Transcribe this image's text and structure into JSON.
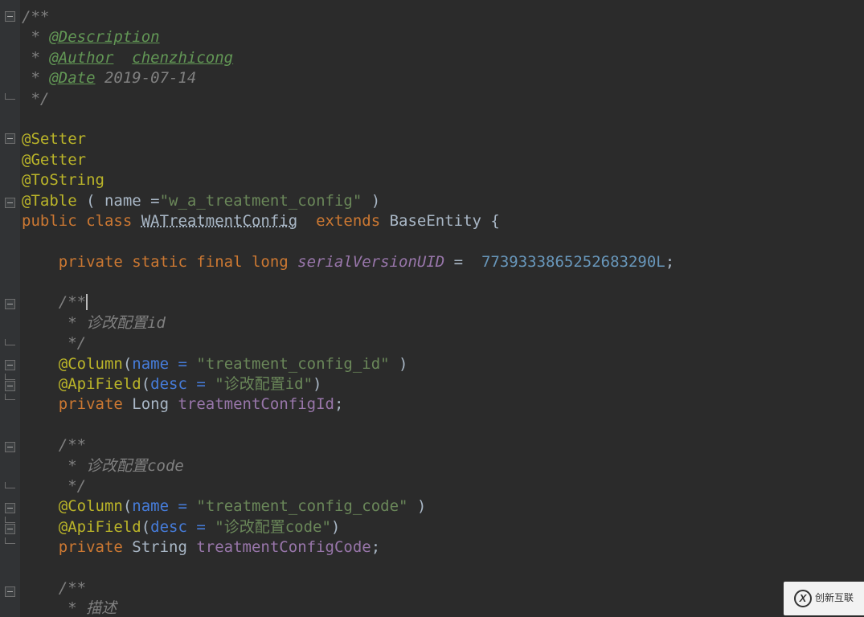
{
  "watermark": {
    "brand_cn": "创新互联",
    "brand_mark": "X"
  },
  "code": {
    "l0": "/**",
    "l1a": " * ",
    "l1b": "@Description",
    "l2a": " * ",
    "l2b": "@Author",
    "l2c": "  ",
    "l2d": "chenzhicong",
    "l3a": " * ",
    "l3b": "@Date",
    "l3c": " 2019-07-14",
    "l4": " */",
    "l5": "",
    "l6": "@Setter",
    "l7": "@Getter",
    "l8": "@ToString",
    "l9a": "@Table ",
    "l9b": "( ",
    "l9c": "name =",
    "l9d": "\"w_a_treatment_config\"",
    "l9e": " )",
    "l10a": "public class ",
    "l10b": "WATreatmentConfig",
    "l10c": "  extends ",
    "l10d": "BaseEntity ",
    "l10e": "{",
    "l11": "",
    "l12a": "    private static final long ",
    "l12b": "serialVersionUID",
    "l12c": " =  ",
    "l12d": "7739333865252683290L",
    "l12e": ";",
    "l13": "",
    "l14": "    /**",
    "l15": "     * 诊改配置id",
    "l16": "     */",
    "l17a": "    ",
    "l17b": "@Column",
    "l17c": "(",
    "l17d": "name = ",
    "l17e": "\"treatment_config_id\"",
    "l17f": " )",
    "l18a": "    ",
    "l18b": "@ApiField",
    "l18c": "(",
    "l18d": "desc = ",
    "l18e": "\"诊改配置id\"",
    "l18f": ")",
    "l19a": "    private ",
    "l19b": "Long ",
    "l19c": "treatmentConfigId",
    "l19d": ";",
    "l20": "",
    "l21": "    /**",
    "l22": "     * 诊改配置code",
    "l23": "     */",
    "l24a": "    ",
    "l24b": "@Column",
    "l24c": "(",
    "l24d": "name = ",
    "l24e": "\"treatment_config_code\"",
    "l24f": " )",
    "l25a": "    ",
    "l25b": "@ApiField",
    "l25c": "(",
    "l25d": "desc = ",
    "l25e": "\"诊改配置code\"",
    "l25f": ")",
    "l26a": "    private ",
    "l26b": "String ",
    "l26c": "treatmentConfigCode",
    "l26d": ";",
    "l27": "",
    "l28": "    /**",
    "l29": "     * 描述"
  }
}
